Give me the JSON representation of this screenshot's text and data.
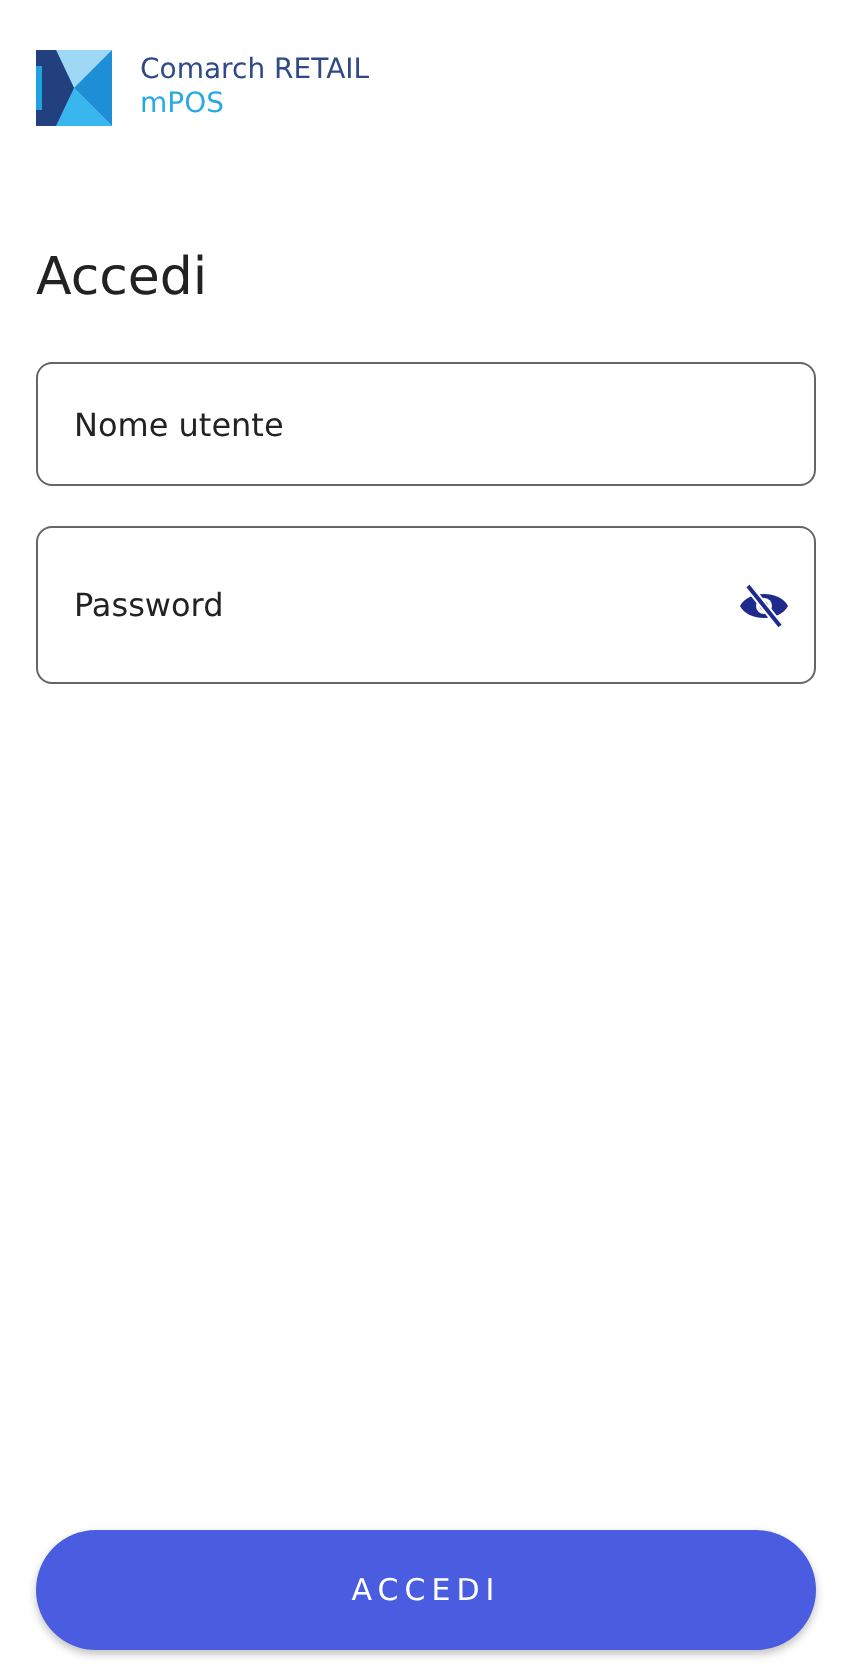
{
  "logo": {
    "brand": "Comarch RETAIL",
    "product": "mPOS"
  },
  "title": "Accedi",
  "fields": [
    {
      "kind": "text",
      "placeholder": "Nome utente"
    },
    {
      "kind": "password",
      "placeholder": "Password",
      "visible": false
    }
  ],
  "submit": "ACCEDI"
}
